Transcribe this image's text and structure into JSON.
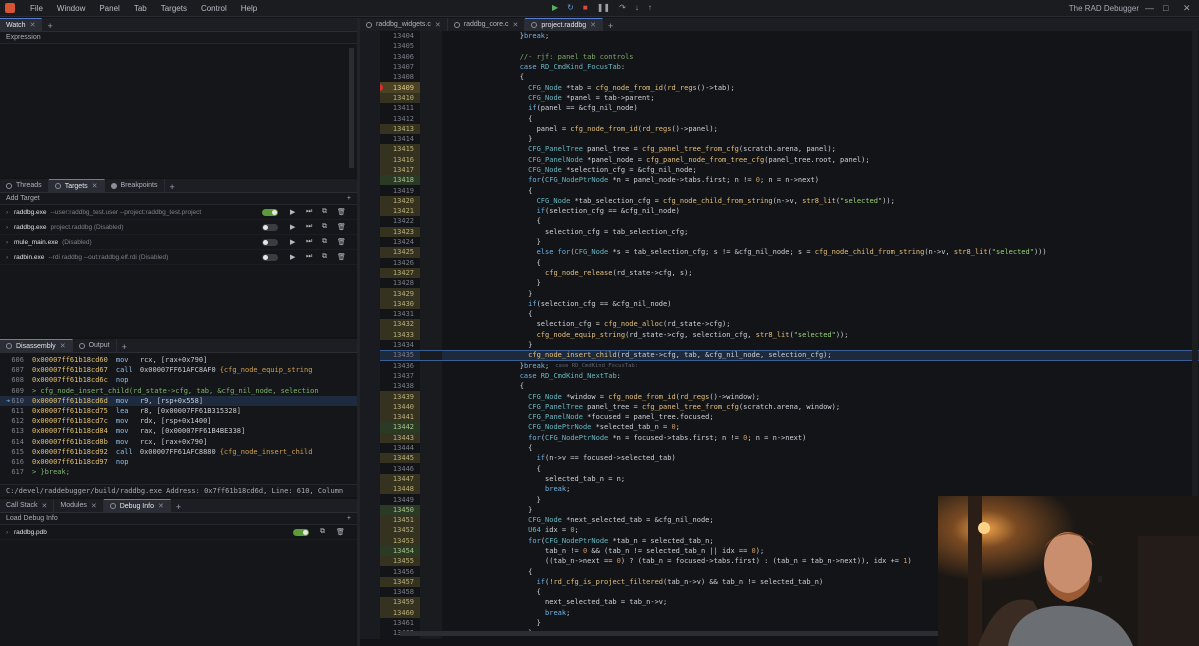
{
  "menu": [
    "File",
    "Window",
    "Panel",
    "Tab",
    "Targets",
    "Control",
    "Help"
  ],
  "app_title": "The RAD Debugger",
  "watch": {
    "tab": "Watch",
    "header": "Expression"
  },
  "targets_panel": {
    "tabs": [
      "Threads",
      "Targets",
      "Breakpoints"
    ],
    "add_label": "Add Target",
    "items": [
      {
        "name": "raddbg.exe",
        "sub": "--user:raddbg_test.user --project:raddbg_test.project",
        "enabled": true
      },
      {
        "name": "raddbg.exe",
        "sub": "project.raddbg  (Disabled)",
        "enabled": false
      },
      {
        "name": "mule_main.exe",
        "sub": "(Disabled)",
        "enabled": false
      },
      {
        "name": "radbin.exe",
        "sub": "--rdi raddbg --out:raddbg.elf.rdi  (Disabled)",
        "enabled": false
      }
    ]
  },
  "disasm_panel": {
    "tabs": [
      "Disassembly",
      "Output"
    ],
    "rows": [
      {
        "ln": "606",
        "addr": "0x00007ff61b18cd60",
        "op": "mov",
        "args": "rcx, [rax+0x790]",
        "sym": ""
      },
      {
        "ln": "607",
        "addr": "0x00007ff61b18cd67",
        "op": "call",
        "args": "0x00007FF61AFC8AF0",
        "sym": "{cfg_node_equip_string"
      },
      {
        "ln": "608",
        "addr": "0x00007ff61b18cd6c",
        "op": "nop",
        "args": "",
        "sym": ""
      },
      {
        "ln": "609",
        "addr": "",
        "op": "",
        "args": "",
        "sym": "",
        "src": ">  cfg_node_insert_child(rd_state->cfg, tab, &cfg_nil_node, selection"
      },
      {
        "ln": "610",
        "addr": "0x00007ff61b18cd6d",
        "op": "mov",
        "args": "r9, [rsp+0x558]",
        "sym": "",
        "cur": true
      },
      {
        "ln": "611",
        "addr": "0x00007ff61b18cd75",
        "op": "lea",
        "args": "r8, [0x00007FF61B315328]",
        "sym": ""
      },
      {
        "ln": "612",
        "addr": "0x00007ff61b18cd7c",
        "op": "mov",
        "args": "rdx, [rsp+0x1400]",
        "sym": ""
      },
      {
        "ln": "613",
        "addr": "0x00007ff61b18cd84",
        "op": "mov",
        "args": "rax, [0x00007FF61B4BE338]",
        "sym": ""
      },
      {
        "ln": "614",
        "addr": "0x00007ff61b18cd8b",
        "op": "mov",
        "args": "rcx, [rax+0x790]",
        "sym": ""
      },
      {
        "ln": "615",
        "addr": "0x00007ff61b18cd92",
        "op": "call",
        "args": "0x00007FF61AFC8880",
        "sym": "{cfg_node_insert_child"
      },
      {
        "ln": "616",
        "addr": "0x00007ff61b18cd97",
        "op": "nop",
        "args": "",
        "sym": ""
      },
      {
        "ln": "617",
        "addr": "",
        "op": "",
        "args": "",
        "sym": "",
        "src": ">  }break;"
      }
    ],
    "status": "C:/devel/raddebugger/build/raddbg.exe     Address: 0x7ff61b18cd6d, Line: 610, Column"
  },
  "modules_panel": {
    "tabs": [
      "Call Stack",
      "Modules",
      "Debug Info"
    ],
    "add_label": "Load Debug Info",
    "items": [
      {
        "name": "raddbg.pdb",
        "enabled": true
      }
    ]
  },
  "editor": {
    "tabs": [
      "raddbg_widgets.c",
      "raddbg_core.c",
      "project.raddbg"
    ],
    "lines": [
      {
        "n": "13404",
        "t": "        }break;",
        "h": "",
        "m": ""
      },
      {
        "n": "13405",
        "t": "",
        "h": "",
        "m": ""
      },
      {
        "n": "13406",
        "t": "        //- rjf: panel tab controls",
        "h": "",
        "m": ""
      },
      {
        "n": "13407",
        "t": "        case RD_CmdKind_FocusTab:",
        "h": "",
        "m": ""
      },
      {
        "n": "13408",
        "t": "        {",
        "h": "",
        "m": ""
      },
      {
        "n": "13409",
        "t": "          CFG_Node *tab = cfg_node_from_id(rd_regs()->tab);",
        "h": "hot",
        "m": "bp"
      },
      {
        "n": "13410",
        "t": "          CFG_Node *panel = tab->parent;",
        "h": "warm",
        "m": ""
      },
      {
        "n": "13411",
        "t": "          if(panel == &cfg_nil_node)",
        "h": "",
        "m": ""
      },
      {
        "n": "13412",
        "t": "          {",
        "h": "",
        "m": ""
      },
      {
        "n": "13413",
        "t": "            panel = cfg_node_from_id(rd_regs()->panel);",
        "h": "warm",
        "m": ""
      },
      {
        "n": "13414",
        "t": "          }",
        "h": "",
        "m": ""
      },
      {
        "n": "13415",
        "t": "          CFG_PanelTree panel_tree = cfg_panel_tree_from_cfg(scratch.arena, panel);",
        "h": "warm",
        "m": ""
      },
      {
        "n": "13416",
        "t": "          CFG_PanelNode *panel_node = cfg_panel_node_from_tree_cfg(panel_tree.root, panel);",
        "h": "warm",
        "m": ""
      },
      {
        "n": "13417",
        "t": "          CFG_Node *selection_cfg = &cfg_nil_node;",
        "h": "warm",
        "m": ""
      },
      {
        "n": "13418",
        "t": "          for(CFG_NodePtrNode *n = panel_node->tabs.first; n != 0; n = n->next)",
        "h": "cool",
        "m": ""
      },
      {
        "n": "13419",
        "t": "          {",
        "h": "",
        "m": ""
      },
      {
        "n": "13420",
        "t": "            CFG_Node *tab_selection_cfg = cfg_node_child_from_string(n->v, str8_lit(\"selected\"));",
        "h": "warm",
        "m": ""
      },
      {
        "n": "13421",
        "t": "            if(selection_cfg == &cfg_nil_node)",
        "h": "warm",
        "m": ""
      },
      {
        "n": "13422",
        "t": "            {",
        "h": "",
        "m": ""
      },
      {
        "n": "13423",
        "t": "              selection_cfg = tab_selection_cfg;",
        "h": "warm",
        "m": ""
      },
      {
        "n": "13424",
        "t": "            }",
        "h": "",
        "m": ""
      },
      {
        "n": "13425",
        "t": "            else for(CFG_Node *s = tab_selection_cfg; s != &cfg_nil_node; s = cfg_node_child_from_string(n->v, str8_lit(\"selected\")))",
        "h": "warm",
        "m": ""
      },
      {
        "n": "13426",
        "t": "            {",
        "h": "",
        "m": ""
      },
      {
        "n": "13427",
        "t": "              cfg_node_release(rd_state->cfg, s);",
        "h": "warm",
        "m": ""
      },
      {
        "n": "13428",
        "t": "            }",
        "h": "",
        "m": ""
      },
      {
        "n": "13429",
        "t": "          }",
        "h": "warm",
        "m": ""
      },
      {
        "n": "13430",
        "t": "          if(selection_cfg == &cfg_nil_node)",
        "h": "warm",
        "m": ""
      },
      {
        "n": "13431",
        "t": "          {",
        "h": "",
        "m": ""
      },
      {
        "n": "13432",
        "t": "            selection_cfg = cfg_node_alloc(rd_state->cfg);",
        "h": "warm",
        "m": ""
      },
      {
        "n": "13433",
        "t": "            cfg_node_equip_string(rd_state->cfg, selection_cfg, str8_lit(\"selected\"));",
        "h": "warm",
        "m": ""
      },
      {
        "n": "13434",
        "t": "          }",
        "h": "",
        "m": ""
      },
      {
        "n": "13435",
        "t": "          cfg_node_insert_child(rd_state->cfg, tab, &cfg_nil_node, selection_cfg);",
        "h": "",
        "m": "ip"
      },
      {
        "n": "13436",
        "t": "        }break;",
        "h": "",
        "m": "",
        "hint": "case RD_CmdKind_FocusTab:"
      },
      {
        "n": "13437",
        "t": "        case RD_CmdKind_NextTab:",
        "h": "",
        "m": ""
      },
      {
        "n": "13438",
        "t": "        {",
        "h": "",
        "m": ""
      },
      {
        "n": "13439",
        "t": "          CFG_Node *window = cfg_node_from_id(rd_regs()->window);",
        "h": "warm",
        "m": ""
      },
      {
        "n": "13440",
        "t": "          CFG_PanelTree panel_tree = cfg_panel_tree_from_cfg(scratch.arena, window);",
        "h": "warm",
        "m": ""
      },
      {
        "n": "13441",
        "t": "          CFG_PanelNode *focused = panel_tree.focused;",
        "h": "warm",
        "m": ""
      },
      {
        "n": "13442",
        "t": "          CFG_NodePtrNode *selected_tab_n = 0;",
        "h": "cool",
        "m": ""
      },
      {
        "n": "13443",
        "t": "          for(CFG_NodePtrNode *n = focused->tabs.first; n != 0; n = n->next)",
        "h": "warm",
        "m": ""
      },
      {
        "n": "13444",
        "t": "          {",
        "h": "",
        "m": ""
      },
      {
        "n": "13445",
        "t": "            if(n->v == focused->selected_tab)",
        "h": "warm",
        "m": ""
      },
      {
        "n": "13446",
        "t": "            {",
        "h": "",
        "m": ""
      },
      {
        "n": "13447",
        "t": "              selected_tab_n = n;",
        "h": "warm",
        "m": ""
      },
      {
        "n": "13448",
        "t": "              break;",
        "h": "warm",
        "m": ""
      },
      {
        "n": "13449",
        "t": "            }",
        "h": "",
        "m": ""
      },
      {
        "n": "13450",
        "t": "          }",
        "h": "cool",
        "m": ""
      },
      {
        "n": "13451",
        "t": "          CFG_Node *next_selected_tab = &cfg_nil_node;",
        "h": "warm",
        "m": ""
      },
      {
        "n": "13452",
        "t": "          U64 idx = 0;",
        "h": "warm",
        "m": ""
      },
      {
        "n": "13453",
        "t": "          for(CFG_NodePtrNode *tab_n = selected_tab_n;",
        "h": "warm",
        "m": ""
      },
      {
        "n": "13454",
        "t": "              tab_n != 0 && (tab_n != selected_tab_n || idx == 0);",
        "h": "cool",
        "m": ""
      },
      {
        "n": "13455",
        "t": "              ((tab_n->next == 0) ? (tab_n = focused->tabs.first) : (tab_n = tab_n->next)), idx += 1)",
        "h": "warm",
        "m": ""
      },
      {
        "n": "13456",
        "t": "          {",
        "h": "",
        "m": ""
      },
      {
        "n": "13457",
        "t": "            if(!rd_cfg_is_project_filtered(tab_n->v) && tab_n != selected_tab_n)",
        "h": "warm",
        "m": ""
      },
      {
        "n": "13458",
        "t": "            {",
        "h": "",
        "m": ""
      },
      {
        "n": "13459",
        "t": "              next_selected_tab = tab_n->v;",
        "h": "warm",
        "m": ""
      },
      {
        "n": "13460",
        "t": "              break;",
        "h": "warm",
        "m": ""
      },
      {
        "n": "13461",
        "t": "            }",
        "h": "",
        "m": ""
      },
      {
        "n": "13462",
        "t": "          }",
        "h": "",
        "m": ""
      }
    ]
  }
}
